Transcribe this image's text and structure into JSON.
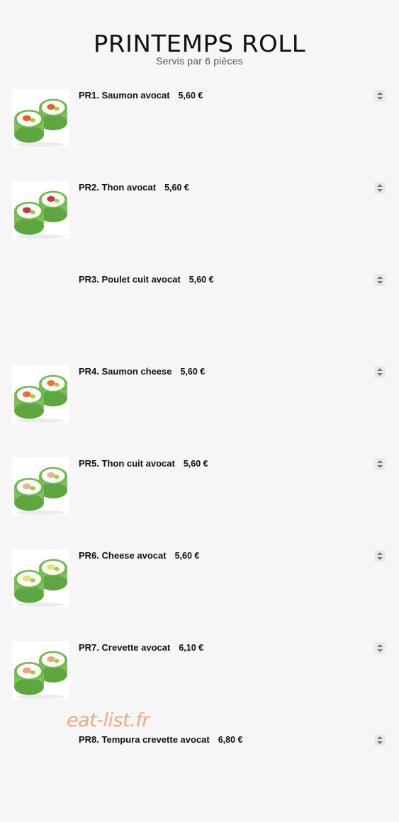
{
  "header": {
    "title": "PRINTEMPS ROLL",
    "subtitle": "Servis par 6 pièces"
  },
  "items": [
    {
      "name": "PR1. Saumon avocat",
      "price": "5,60 €",
      "has_image": true,
      "filling": "salmon",
      "filling_color": "#e85d2c"
    },
    {
      "name": "PR2. Thon avocat",
      "price": "5,60 €",
      "has_image": true,
      "filling": "tuna",
      "filling_color": "#d3304a"
    },
    {
      "name": "PR3. Poulet cuit avocat",
      "price": "5,60 €",
      "has_image": false
    },
    {
      "name": "PR4. Saumon cheese",
      "price": "5,60 €",
      "has_image": true,
      "filling": "salmon",
      "filling_color": "#f06a3a"
    },
    {
      "name": "PR5. Thon cuit avocat",
      "price": "5,60 €",
      "has_image": true,
      "filling": "cooked-tuna",
      "filling_color": "#e9b49a"
    },
    {
      "name": "PR6. Cheese avocat",
      "price": "5,60 €",
      "has_image": true,
      "filling": "cheese",
      "filling_color": "#e8e070"
    },
    {
      "name": "PR7. Crevette avocat",
      "price": "6,10 €",
      "has_image": true,
      "filling": "shrimp",
      "filling_color": "#f2a27a"
    },
    {
      "name": "PR8. Tempura crevette avocat",
      "price": "6,80 €",
      "has_image": false
    }
  ],
  "watermark": "eat-list.fr",
  "colors": {
    "background": "#f6f6f6",
    "leaf": "#7cc25a",
    "rice": "#fbfbf3",
    "watermark": "#f0a07a"
  },
  "icons": {
    "quantity_stepper": "up-down-arrows-icon"
  }
}
